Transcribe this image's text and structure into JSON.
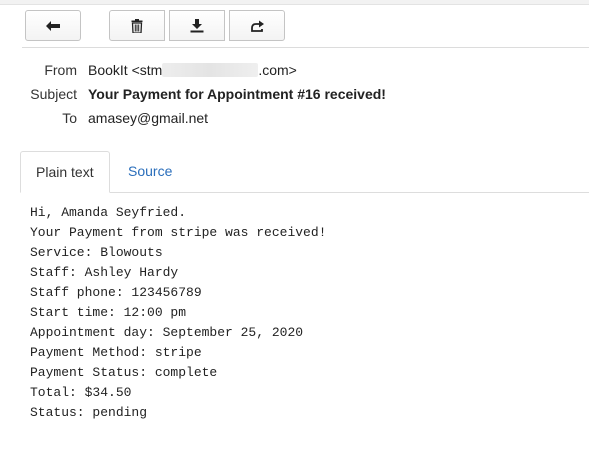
{
  "toolbar": {
    "buttons": [
      {
        "icon": "back-arrow-icon"
      },
      {
        "icon": "trash-icon"
      },
      {
        "icon": "download-icon"
      },
      {
        "icon": "share-icon"
      }
    ]
  },
  "headers": {
    "from_label": "From",
    "from_value_prefix": "BookIt <stm",
    "from_value_suffix": ".com>",
    "subject_label": "Subject",
    "subject_value": "Your Payment for Appointment #16 received!",
    "to_label": "To",
    "to_value": "amasey@gmail.net"
  },
  "tabs": {
    "plain_text": "Plain text",
    "source": "Source"
  },
  "body_lines": [
    "Hi, Amanda Seyfried.",
    "Your Payment from stripe was received!",
    "Service: Blowouts",
    "Staff: Ashley Hardy",
    "Staff phone: 123456789",
    "Start time: 12:00 pm",
    "Appointment day: September 25, 2020",
    "Payment Method: stripe",
    "Payment Status: complete",
    "Total: $34.50",
    "Status: pending"
  ],
  "colors": {
    "link": "#2a6ebb",
    "border": "#c4c4c4"
  }
}
